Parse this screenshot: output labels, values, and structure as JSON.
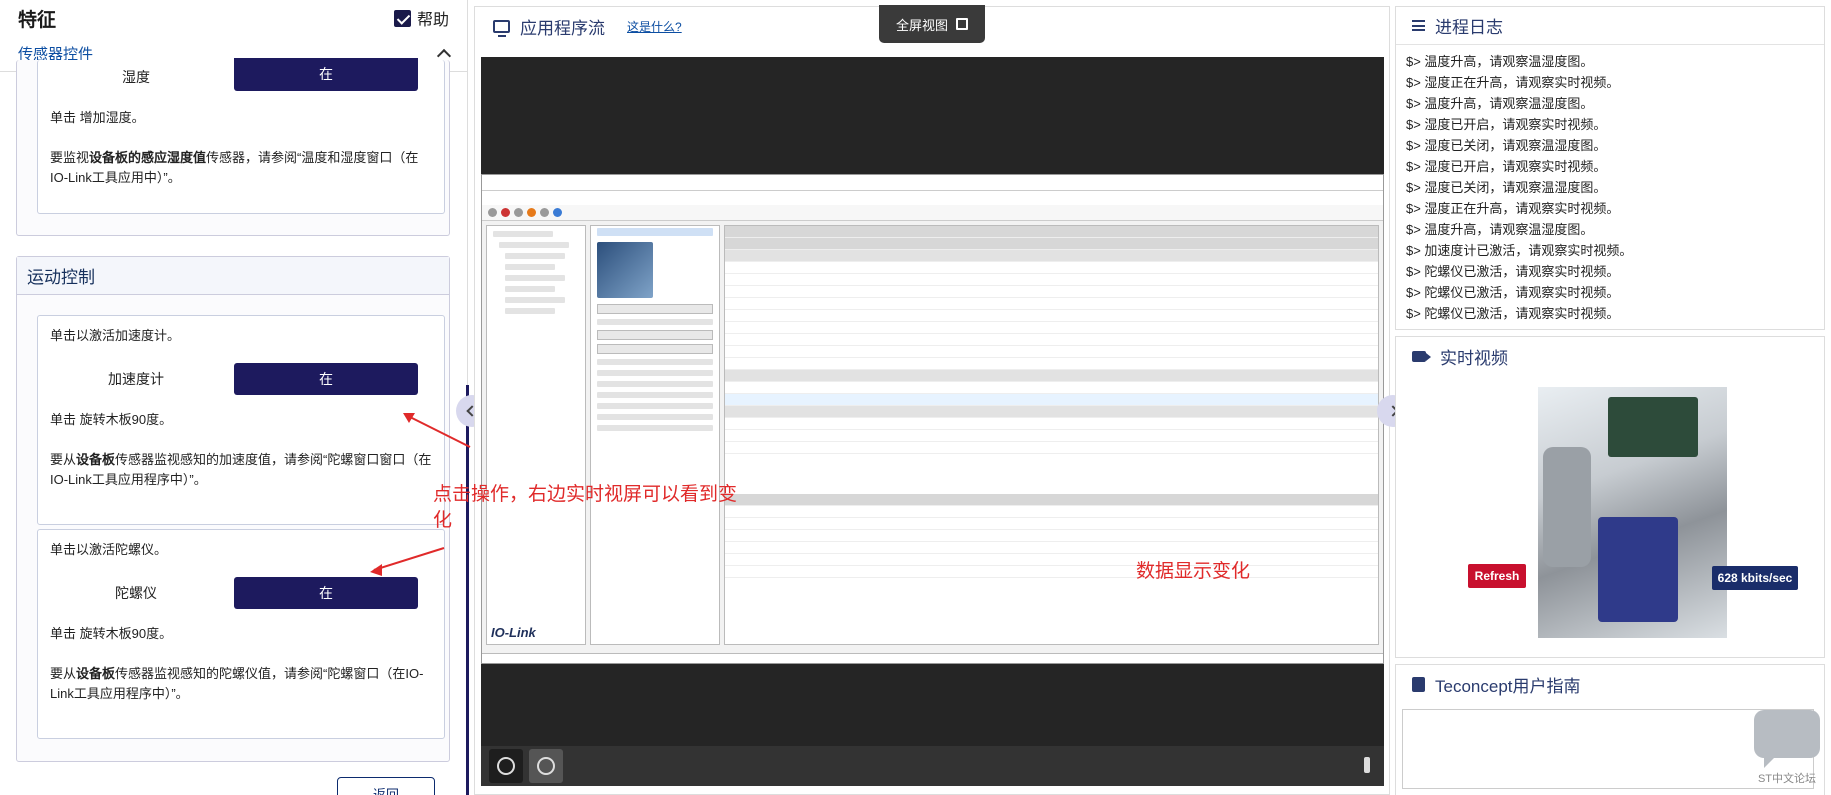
{
  "left": {
    "title": "特征",
    "help_label": "帮助",
    "subheader": "传感器控件",
    "humidity_card": {
      "label": "湿度",
      "button": "在",
      "desc": "单击 增加湿度。",
      "note_pre": "要监视",
      "note_bold": "设备板的感应湿度值",
      "note_post": "传感器，请参阅“温度和湿度窗口（在IO-Link工具应用中）”。"
    },
    "motion_section": {
      "title": "运动控制",
      "accel_card": {
        "intro": "单击以激活加速度计。",
        "label": "加速度计",
        "button": "在",
        "desc": "单击 旋转木板90度。",
        "note_pre": "要从",
        "note_bold": "设备板",
        "note_post": "传感器监视感知的加速度值，请参阅“陀螺窗口窗口（在IO-Link工具应用程序中）”。"
      },
      "gyro_card": {
        "intro": "单击以激活陀螺仪。",
        "label": "陀螺仪",
        "button": "在",
        "desc": "单击 旋转木板90度。",
        "note_pre": "要从",
        "note_bold": "设备板",
        "note_post": "传感器监视感知的陀螺仪值，请参阅“陀螺窗口（在IO-Link工具应用程序中）”。"
      }
    },
    "back_button": "返回"
  },
  "middle": {
    "title": "应用程序流",
    "what_link": "这是什么?",
    "fullscreen_label": "全屏视图",
    "annotation_left": "点击操作，右边实时视屏可以看到变化",
    "annotation_right": "数据显示变化",
    "app": {
      "logo": "IO-Link"
    }
  },
  "right": {
    "log": {
      "title": "进程日志",
      "entries": [
        "$> 温度升高，请观察温湿度图。",
        "$> 湿度正在升高，请观察实时视频。",
        "$> 温度升高，请观察温湿度图。",
        "$> 湿度已开启，请观察实时视频。",
        "$> 湿度已关闭，请观察温湿度图。",
        "$> 湿度已开启，请观察实时视频。",
        "$> 湿度已关闭，请观察温湿度图。",
        "$> 湿度正在升高，请观察实时视频。",
        "$> 温度升高，请观察温湿度图。",
        "$> 加速度计已激活，请观察实时视频。",
        "$> 陀螺仪已激活，请观察实时视频。",
        "$> 陀螺仪已激活，请观察实时视频。",
        "$> 陀螺仪已激活，请观察实时视频。"
      ]
    },
    "video": {
      "title": "实时视频",
      "refresh_label": "Refresh",
      "bitrate": "628 kbits/sec"
    },
    "guide": {
      "title": "Teconcept用户指南"
    },
    "forum_label": "ST中文论坛"
  }
}
